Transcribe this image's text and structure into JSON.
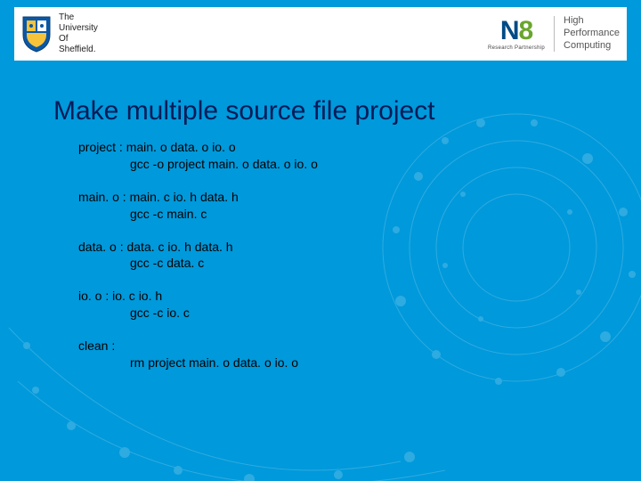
{
  "header": {
    "left": {
      "uni_line1": "The",
      "uni_line2": "University",
      "uni_line3": "Of",
      "uni_line4": "Sheffield."
    },
    "right": {
      "n8_letter": "N",
      "n8_digit": "8",
      "n8_sub": "Research Partnership",
      "hpc_line1": "High",
      "hpc_line2": "Performance",
      "hpc_line3": "Computing"
    }
  },
  "slide": {
    "title": "Make multiple source file project",
    "rules": [
      {
        "target": "project : main. o data. o io. o",
        "cmd": "gcc -o project main. o data. o io. o"
      },
      {
        "target": "main. o : main. c io. h data. h",
        "cmd": "gcc -c main. c"
      },
      {
        "target": "data. o : data. c io. h data. h",
        "cmd": "gcc -c data. c"
      },
      {
        "target": "io. o : io. c io. h",
        "cmd": "gcc -c io. c"
      },
      {
        "target": "clean :",
        "cmd": "rm project main. o data. o io. o"
      }
    ]
  }
}
